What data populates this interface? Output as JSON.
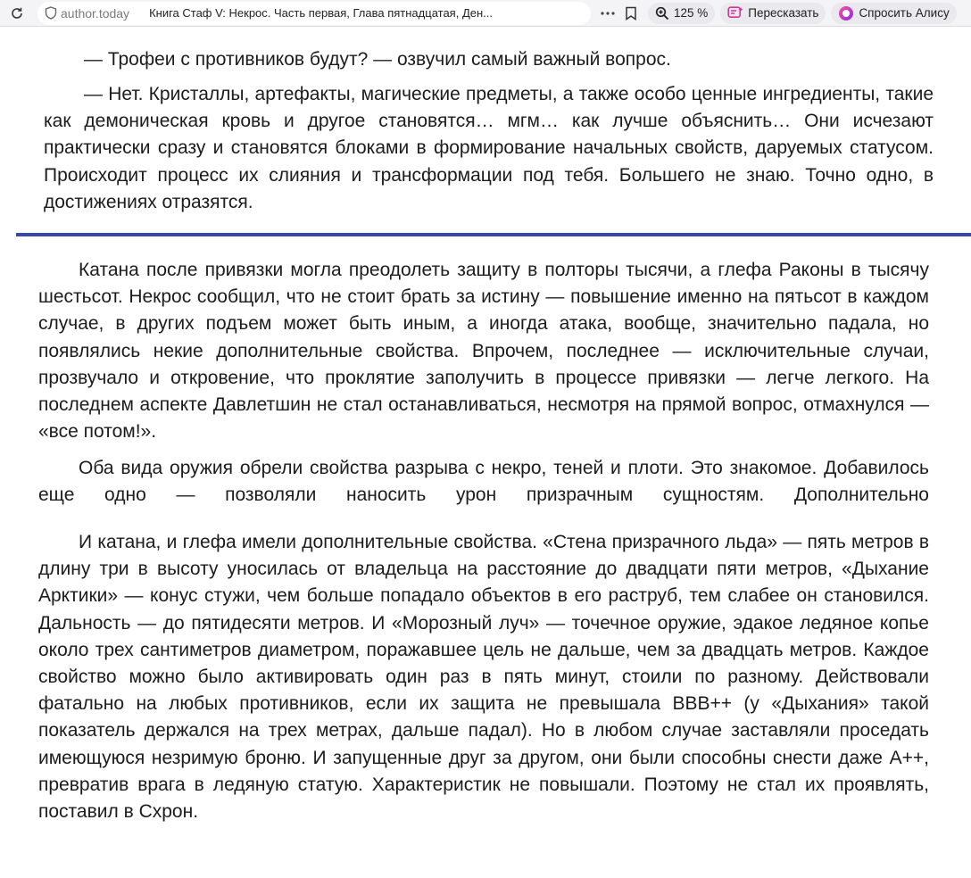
{
  "browser": {
    "site": "author.today",
    "title": "Книга Стаф V: Некрос. Часть первая, Глава пятнадцатая, Ден...",
    "zoom": "125 %",
    "retell_label": "Пересказать",
    "ask_label": "Спросить Алису"
  },
  "article": {
    "block1": [
      "— Трофеи с противников будут? — озвучил самый важный вопрос.",
      "— Нет. Кристаллы, артефакты, магические предметы, а также особо ценные ингредиенты, такие как демоническая кровь и другое становятся… мгм… как лучше объяснить… Они исчезают практически сразу и становятся блоками в формирование начальных свойств, даруемых статусом. Происходит процесс их слияния и трансформации под тебя. Большего не знаю. Точно одно, в достижениях отразятся."
    ],
    "block2": [
      "Катана после привязки могла преодолеть защиту в полторы тысячи, а глефа Раконы в тысячу шестьсот. Некрос сообщил, что не стоит брать за истину — повышение именно на пятьсот в каждом случае, в других подъем может быть иным, а иногда атака, вообще, значительно падала, но появлялись некие дополнительные свойства. Впрочем, последнее — исключительные случаи, прозвучало и откровение, что проклятие заполучить в процессе привязки — легче легкого. На последнем аспекте Давлетшин не стал останавливаться, несмотря на прямой вопрос, отмахнулся — «все потом!».",
      "Оба вида оружия обрели свойства разрыва с некро, теней и плоти. Это знакомое. Добавилось еще одно — позволяли наносить урон призрачным сущностям. Дополнительно",
      "И катана, и глефа имели дополнительные свойства. «Стена призрачного льда» — пять метров в длину три в высоту уносилась от владельца на расстояние до двадцати пяти метров, «Дыхание Арктики» — конус стужи, чем больше попадало объектов в его раструб, тем слабее он становился. Дальность — до пятидесяти метров. И «Морозный луч» — точечное оружие, эдакое ледяное копье около трех сантиметров диаметром, поражавшее цель не дальше, чем за двадцать метров. Каждое свойство можно было активировать один раз в пять минут, стоили по разному. Действовали фатально на любых противников, если их защита не превышала ВВВ++ (у «Дыхания» такой показатель держался на трех метрах, дальше падал). Но в любом случае заставляли проседать имеющуюся незримую броню. И запущенные друг за другом, они были способны снести даже А++, превратив врага в ледяную статую. Характеристик не повышали. Поэтому не стал их проявлять, поставил в Схрон."
    ]
  }
}
